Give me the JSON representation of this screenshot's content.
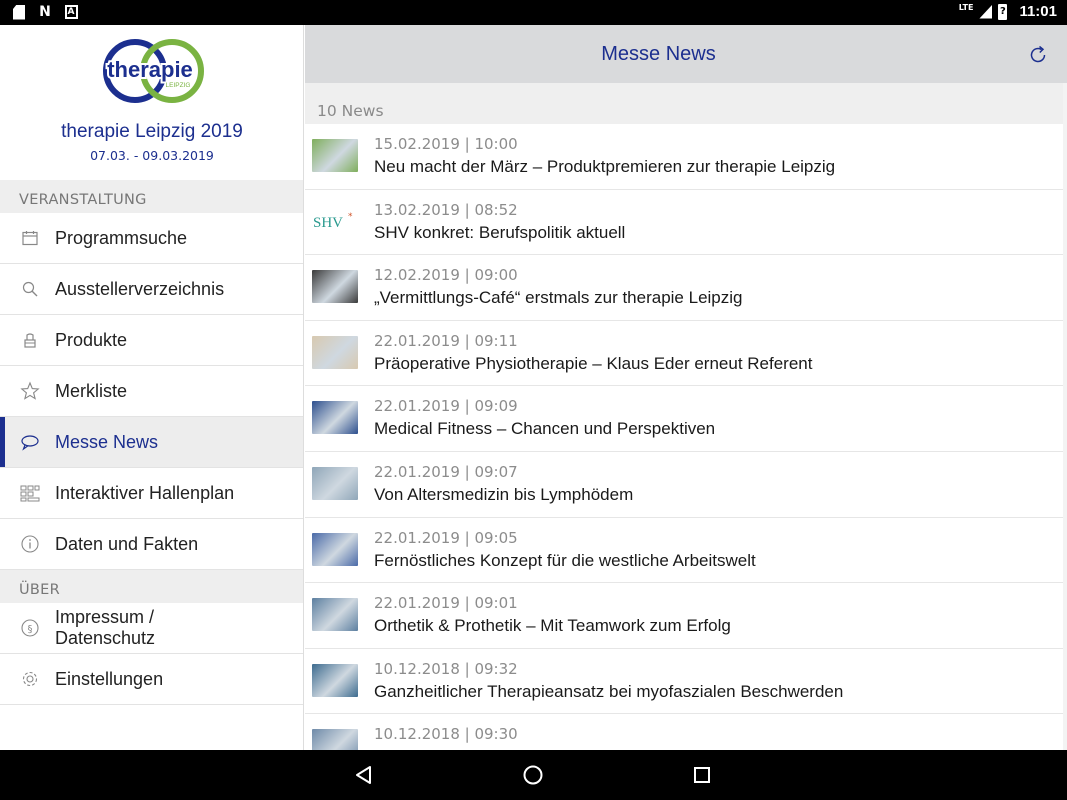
{
  "status_bar": {
    "network": "LTE",
    "battery_label": "?",
    "time": "11:01"
  },
  "sidebar": {
    "brand": {
      "logo_word": "therapie",
      "logo_sub": "LEIPZIG",
      "title": "therapie Leipzig 2019",
      "dates": "07.03. - 09.03.2019"
    },
    "sections": [
      {
        "header": "VERANSTALTUNG"
      },
      {
        "header": "ÜBER"
      }
    ],
    "items": [
      {
        "label": "Programmsuche",
        "icon": "calendar-icon"
      },
      {
        "label": "Ausstellerverzeichnis",
        "icon": "search-icon"
      },
      {
        "label": "Produkte",
        "icon": "product-icon"
      },
      {
        "label": "Merkliste",
        "icon": "star-icon"
      },
      {
        "label": "Messe News",
        "icon": "chat-bubble-icon",
        "active": true
      },
      {
        "label": "Interaktiver Hallenplan",
        "icon": "floorplan-icon"
      },
      {
        "label": "Daten und Fakten",
        "icon": "info-icon"
      },
      {
        "label": "Impressum / Datenschutz",
        "icon": "paragraph-icon"
      },
      {
        "label": "Einstellungen",
        "icon": "gear-icon"
      }
    ]
  },
  "main": {
    "title": "Messe News",
    "count_label": "10 News",
    "news": [
      {
        "date": "15.02.2019 | 10:00",
        "title": "Neu macht der März – Produktpremieren zur therapie Leipzig",
        "thumb": "#7fae5c"
      },
      {
        "date": "13.02.2019 | 08:52",
        "title": "SHV konkret: Berufspolitik aktuell",
        "thumb": "shv"
      },
      {
        "date": "12.02.2019 | 09:00",
        "title": "„Vermittlungs-Café“ erstmals zur therapie Leipzig",
        "thumb": "#3a3a3a"
      },
      {
        "date": "22.01.2019 | 09:11",
        "title": "Präoperative Physiotherapie – Klaus Eder erneut Referent",
        "thumb": "#d8c9b0"
      },
      {
        "date": "22.01.2019 | 09:09",
        "title": "Medical Fitness – Chancen und Perspektiven",
        "thumb": "#2d4f8e"
      },
      {
        "date": "22.01.2019 | 09:07",
        "title": "Von Altersmedizin bis Lymphödem",
        "thumb": "#8fa6b8"
      },
      {
        "date": "22.01.2019 | 09:05",
        "title": "Fernöstliches Konzept für die westliche Arbeitswelt",
        "thumb": "#4a6aa8"
      },
      {
        "date": "22.01.2019 | 09:01",
        "title": "Orthetik & Prothetik – Mit Teamwork zum Erfolg",
        "thumb": "#5c7fa0"
      },
      {
        "date": "10.12.2018 | 09:32",
        "title": "Ganzheitlicher Therapieansatz bei myofaszialen Beschwerden",
        "thumb": "#3d6b8f"
      },
      {
        "date": "10.12.2018 | 09:30",
        "title": "",
        "thumb": "#6e8aa8"
      }
    ]
  },
  "colors": {
    "brand_blue": "#1c2f8f",
    "brand_green": "#7ab342"
  }
}
